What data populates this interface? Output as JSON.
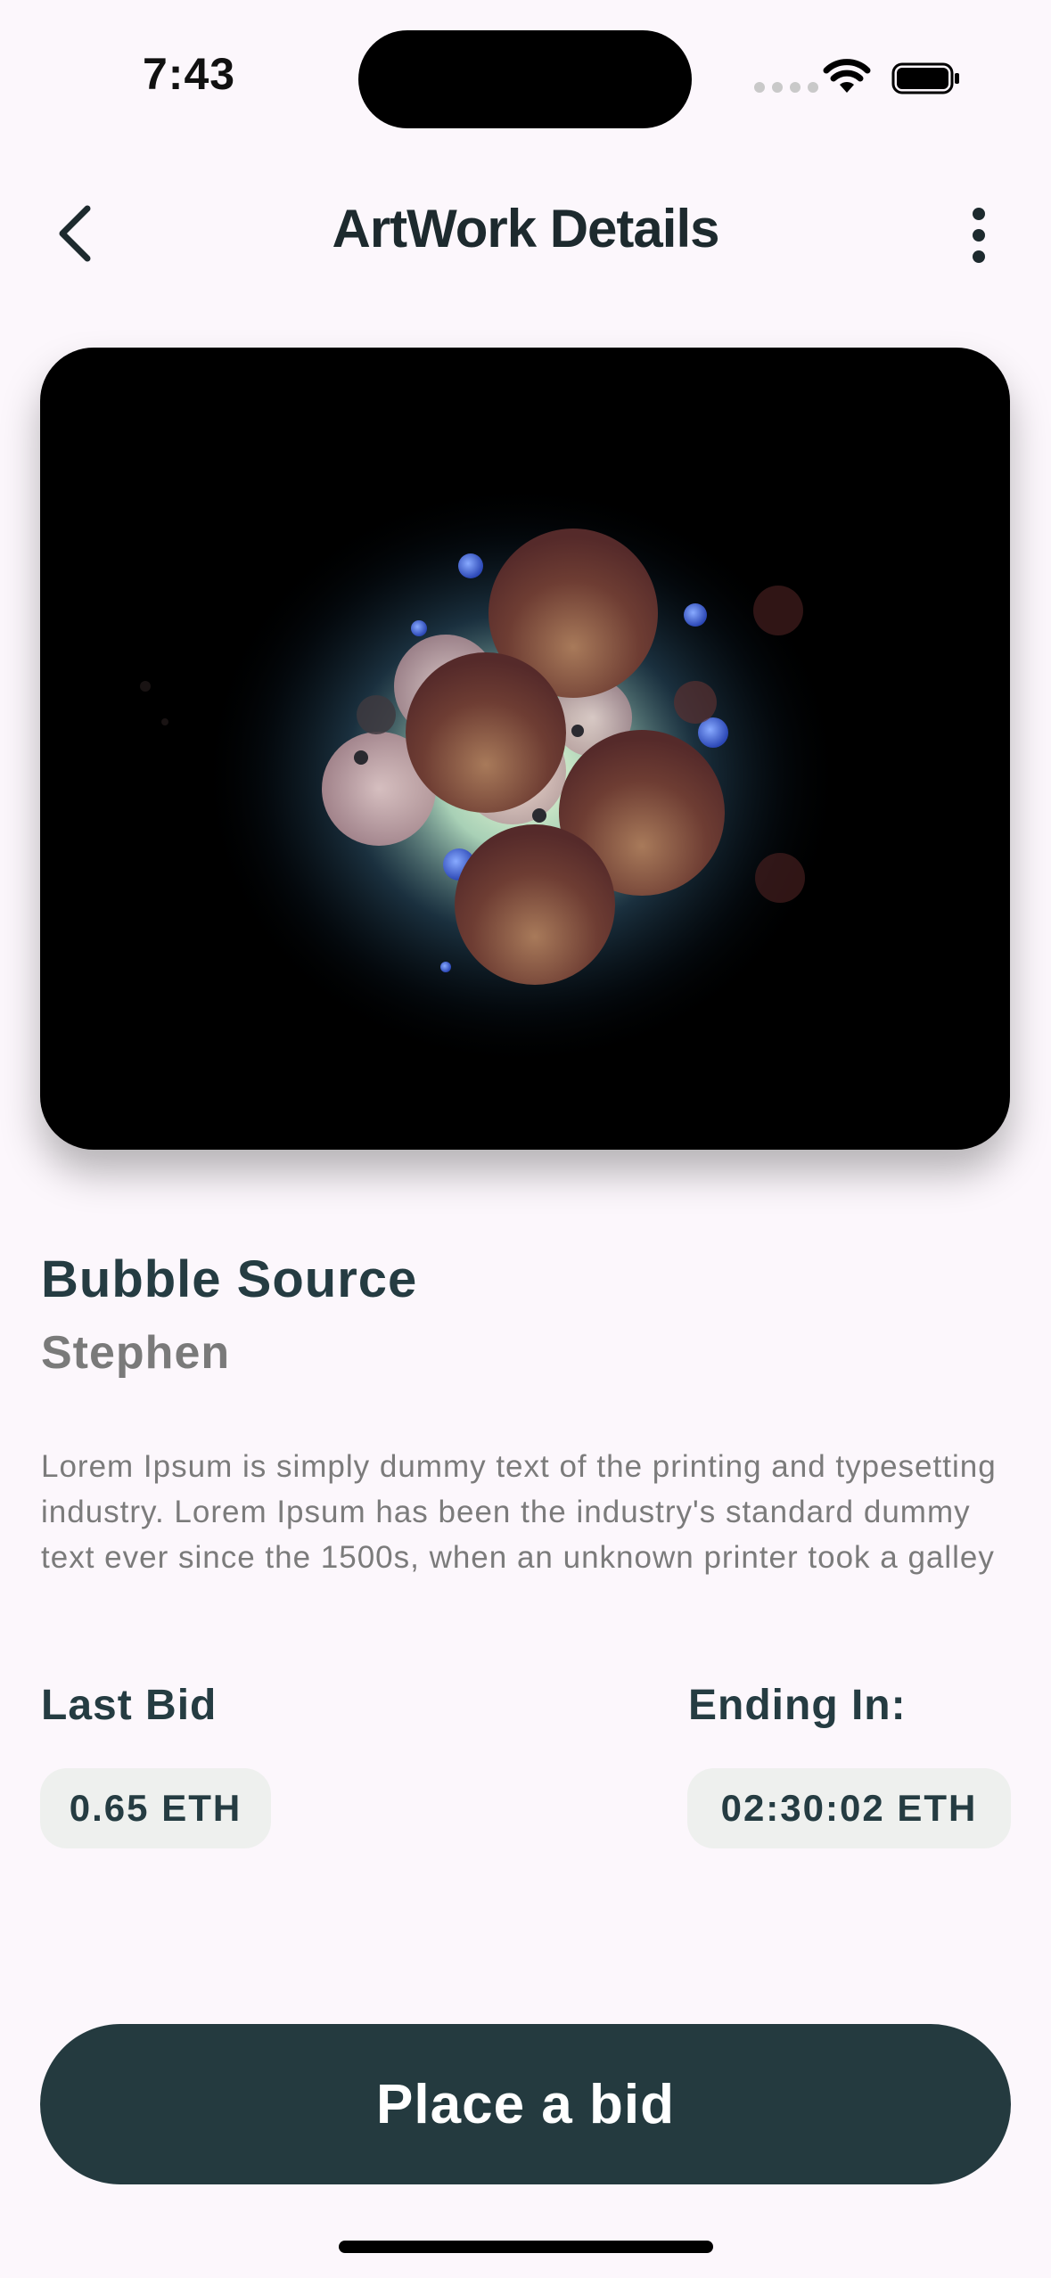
{
  "status": {
    "time": "7:43"
  },
  "header": {
    "title": "ArtWork Details"
  },
  "artwork": {
    "title": "Bubble Source",
    "artist": "Stephen",
    "description": "Lorem Ipsum is simply dummy text of the printing and typesetting industry. Lorem Ipsum has been the industry's standard dummy text ever since the 1500s, when an unknown printer took a galley"
  },
  "bid": {
    "last_bid_label": "Last Bid",
    "last_bid_value": "0.65 ETH",
    "ending_label": "Ending In:",
    "ending_value": "02:30:02 ETH",
    "button_label": "Place a bid"
  },
  "colors": {
    "primary": "#243a3f",
    "background": "#fcf7fc",
    "pill": "#eef0ee",
    "muted": "#7a7a7a"
  },
  "icons": [
    "back-arrow-icon",
    "more-vertical-icon",
    "wifi-icon",
    "battery-icon",
    "signal-icon"
  ]
}
